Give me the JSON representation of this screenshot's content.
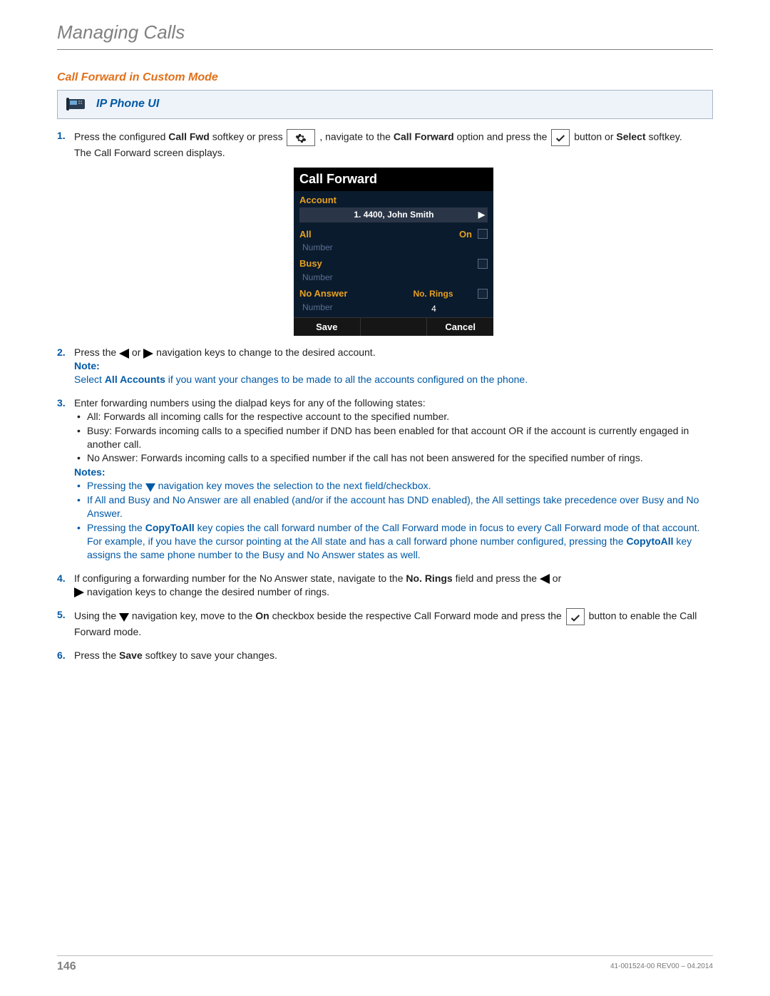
{
  "header": {
    "chapter": "Managing Calls"
  },
  "section": {
    "title": "Call Forward in Custom Mode"
  },
  "callout": {
    "title": "IP Phone UI"
  },
  "step1": {
    "t1": "Press the configured ",
    "b1": "Call Fwd",
    "t2": " softkey or press ",
    "t3": " , navigate to the ",
    "b2": "Call Forward",
    "t4": " option and press the ",
    "t5": " button or ",
    "b3": "Select",
    "t6": " softkey.",
    "line2": "The Call Forward screen displays."
  },
  "phone": {
    "title": "Call Forward",
    "account_label": "Account",
    "account_value": "1. 4400, John Smith",
    "all_label": "All",
    "on_label": "On",
    "number_label": "Number",
    "busy_label": "Busy",
    "noanswer_label": "No Answer",
    "norings_label": "No. Rings",
    "norings_value": "4",
    "save_btn": "Save",
    "cancel_btn": "Cancel"
  },
  "step2": {
    "t1": "Press the ",
    "t2": " or ",
    "t3": " navigation keys to change to the desired account.",
    "note_label": "Note:",
    "note_t1": "Select ",
    "note_b1": "All Accounts",
    "note_t2": " if you want your changes to be made to all the accounts configured on the phone."
  },
  "step3": {
    "intro": "Enter forwarding numbers using the dialpad keys for any of the following states:",
    "bullets": [
      "All: Forwards all incoming calls for the respective account to the specified number.",
      "Busy: Forwards incoming calls to a specified number if DND has been enabled for that account OR if the account is currently engaged in another call.",
      "No Answer: Forwards incoming calls to a specified number if the call has not been answered for the specified number of rings."
    ],
    "notes_label": "Notes:",
    "note1_a": "Pressing the ",
    "note1_b": " navigation key moves the selection to the next field/checkbox.",
    "note2": "If All and Busy and No Answer are all enabled (and/or if the account has DND enabled), the All settings take precedence over Busy and No Answer.",
    "note3_a": "Pressing the ",
    "note3_b1": "CopyToAll",
    "note3_c": " key copies the call forward number of the Call Forward mode in focus to every Call Forward mode of that account. For example, if you have the cursor pointing at the All state and has a call forward phone number configured, pressing the ",
    "note3_b2": "CopytoAll",
    "note3_d": " key assigns the same phone number to the Busy and No Answer states as well."
  },
  "step4": {
    "t1": "If configuring a forwarding number for the No Answer state, navigate to the ",
    "b1": "No. Rings",
    "t2": " field and press the ",
    "t3": " or ",
    "t4": " navigation keys to change the desired number of rings."
  },
  "step5": {
    "t1": "Using the ",
    "t2": " navigation key, move to the ",
    "b1": "On",
    "t3": " checkbox beside the respective Call Forward mode and press the ",
    "t4": " button to enable the Call Forward mode."
  },
  "step6": {
    "t1": "Press the ",
    "b1": "Save",
    "t2": " softkey to save your changes."
  },
  "footer": {
    "page": "146",
    "docid": "41-001524-00 REV00 – 04.2014"
  }
}
